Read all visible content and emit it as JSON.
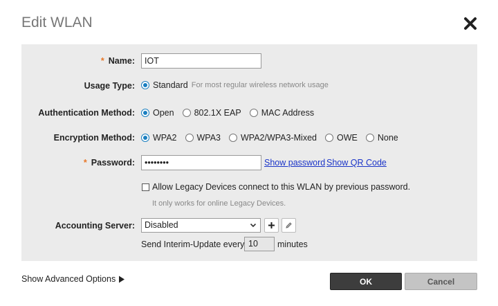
{
  "dialog": {
    "title": "Edit WLAN"
  },
  "form": {
    "name": {
      "label": "Name:",
      "required_mark": "*",
      "value": "IOT"
    },
    "usage_type": {
      "label": "Usage Type:",
      "option": "Standard",
      "hint": "For most regular wireless network usage",
      "selected": "Standard"
    },
    "auth_method": {
      "label": "Authentication Method:",
      "options": [
        "Open",
        "802.1X EAP",
        "MAC Address"
      ],
      "selected": "Open"
    },
    "encryption_method": {
      "label": "Encryption Method:",
      "options": [
        "WPA2",
        "WPA3",
        "WPA2/WPA3-Mixed",
        "OWE",
        "None"
      ],
      "selected": "WPA2"
    },
    "password": {
      "label": "Password:",
      "required_mark": "*",
      "value": "••••••••",
      "show_password": "Show password",
      "show_qr": "Show QR Code"
    },
    "legacy": {
      "label": "Allow Legacy Devices connect to this WLAN by previous password.",
      "checked": false,
      "note": "It only works for online Legacy Devices."
    },
    "accounting": {
      "label": "Accounting Server:",
      "selected": "Disabled",
      "interim_prefix": "Send Interim-Update every",
      "interim_value": "10",
      "interim_suffix": "minutes"
    }
  },
  "footer": {
    "advanced": "Show Advanced Options",
    "ok": "OK",
    "cancel": "Cancel"
  },
  "colors": {
    "accent": "#1a7fc0",
    "required": "#e8782a",
    "link": "#1a34c8",
    "panel": "#ebebeb"
  }
}
